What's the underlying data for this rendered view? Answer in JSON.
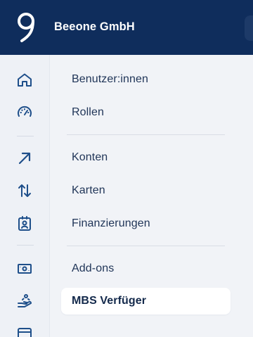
{
  "header": {
    "company_name": "Beeone GmbH",
    "logo_icon": "beeone-logo-icon",
    "background_color": "#0f2d5c"
  },
  "rail": {
    "icons": [
      "home-icon",
      "gauge-icon",
      "arrow-up-right-icon",
      "transfer-arrows-icon",
      "id-card-icon",
      "banknote-icon",
      "hand-coin-icon",
      "card-icon"
    ],
    "icon_color": "#1e4f8a"
  },
  "menu": {
    "items": [
      {
        "label": "Benutzer:innen"
      },
      {
        "label": "Rollen"
      },
      {
        "label": "Konten"
      },
      {
        "label": "Karten"
      },
      {
        "label": "Finanzierungen"
      },
      {
        "label": "Add-ons"
      },
      {
        "label": "MBS Verfüger",
        "active": true
      }
    ]
  }
}
